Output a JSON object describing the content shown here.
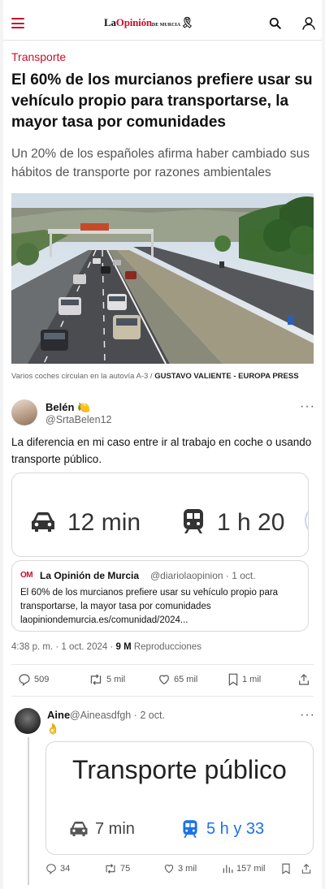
{
  "header": {
    "logo_prefix": "La",
    "logo_main": "Opinión",
    "logo_suffix": "DE MURCIA",
    "icons": [
      "menu-icon",
      "search-icon",
      "user-icon"
    ]
  },
  "article": {
    "category": "Transporte",
    "headline": "El 60% de los murcianos prefiere usar su vehículo propio para transportarse, la mayor tasa por comunidades",
    "subtitle": "Un 20% de los españoles afirma haber cambiado sus hábitos de transporte por razones ambientales",
    "photo_caption": "Varios coches circulan en la autovía A-3 / ",
    "photo_credit": "GUSTAVO VALIENTE - EUROPA PRESS"
  },
  "tweet1": {
    "name": "Belén",
    "emoji": "🍋",
    "handle": "@SrtaBelen12",
    "text": "La diferencia en mi caso entre ir al trabajo en coche o usando transporte público.",
    "card": {
      "car_time": "12 min",
      "transit_time": "1 h 20"
    },
    "quote": {
      "logo": "OM",
      "name": "La Opinión de Murcia",
      "meta": "@diariolaopinion · 1 oct.",
      "text": "El 60% de los murcianos prefiere usar su vehículo propio para transportarse, la mayor tasa por comunidades",
      "link": "laopiniondemurcia.es/comunidad/2024..."
    },
    "time": "4:38 p. m. · 1 oct. 2024 · ",
    "views_count": "9 M",
    "views_label": " Reproducciones",
    "actions": {
      "replies": "509",
      "retweets": "5 mil",
      "likes": "65 mil",
      "bookmarks": "1 mil"
    }
  },
  "tweet2": {
    "name": "Aine",
    "handle_meta": "@Aineasdfgh · 2 oct.",
    "emoji": "👌",
    "card": {
      "title": "Transporte público",
      "car_time": "7 min",
      "transit_time": "5 h y 33"
    },
    "actions": {
      "replies": "34",
      "retweets": "75",
      "likes": "3 mil",
      "views": "157 mil"
    }
  },
  "colors": {
    "brand_red": "#c8102e",
    "transit_blue": "#1a73e8",
    "text_gray": "#666666"
  }
}
